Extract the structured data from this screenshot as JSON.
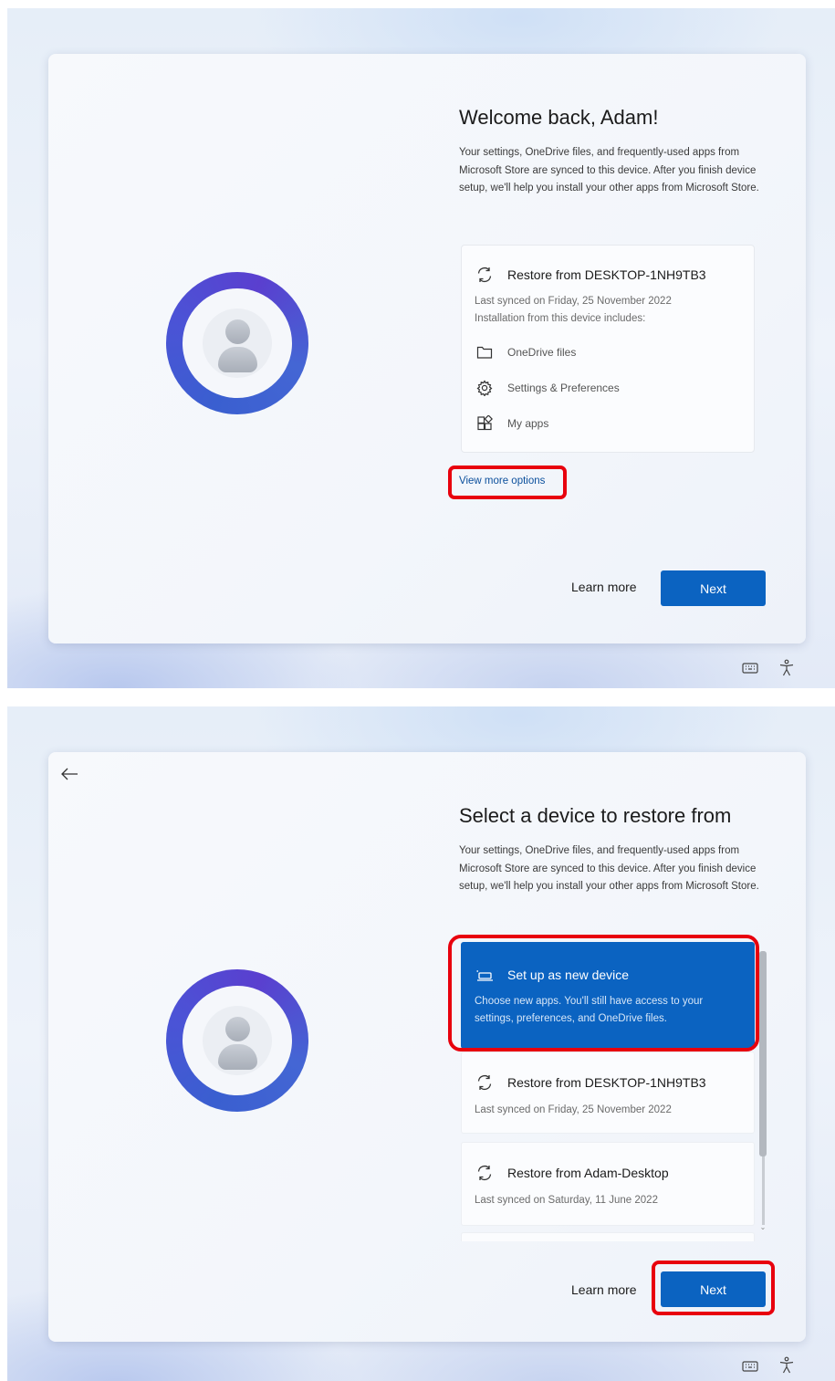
{
  "screen1": {
    "title": "Welcome back, Adam!",
    "description": "Your settings, OneDrive files, and frequently-used apps from Microsoft Store are synced to this device. After you finish device setup, we'll help you install your other apps from Microsoft Store.",
    "restore_title": "Restore from DESKTOP-1NH9TB3",
    "restore_sync": "Last synced on Friday, 25 November 2022",
    "restore_includes": "Installation from this device includes:",
    "items": [
      "OneDrive files",
      "Settings & Preferences",
      "My apps"
    ],
    "view_more": "View more options",
    "learn_more": "Learn more",
    "next": "Next"
  },
  "screen2": {
    "title": "Select a device to restore from",
    "description": "Your settings, OneDrive files, and frequently-used apps from Microsoft Store are synced to this device. After you finish device setup, we'll help you install your other apps from Microsoft Store.",
    "options": [
      {
        "title": "Set up as new device",
        "sub": "Choose new apps. You'll still have access to your settings, preferences, and OneDrive files.",
        "selected": true
      },
      {
        "title": "Restore from DESKTOP-1NH9TB3",
        "sub": "Last synced on Friday, 25 November 2022",
        "selected": false
      },
      {
        "title": "Restore from Adam-Desktop",
        "sub": "Last synced on Saturday, 11 June 2022",
        "selected": false
      }
    ],
    "learn_more": "Learn more",
    "next": "Next"
  },
  "colors": {
    "accent": "#0b63c1",
    "highlight": "#e8000d"
  },
  "icons": [
    "sync-icon",
    "folder-icon",
    "gear-icon",
    "apps-icon",
    "keyboard-icon",
    "accessibility-icon",
    "back-arrow-icon",
    "new-device-icon"
  ]
}
